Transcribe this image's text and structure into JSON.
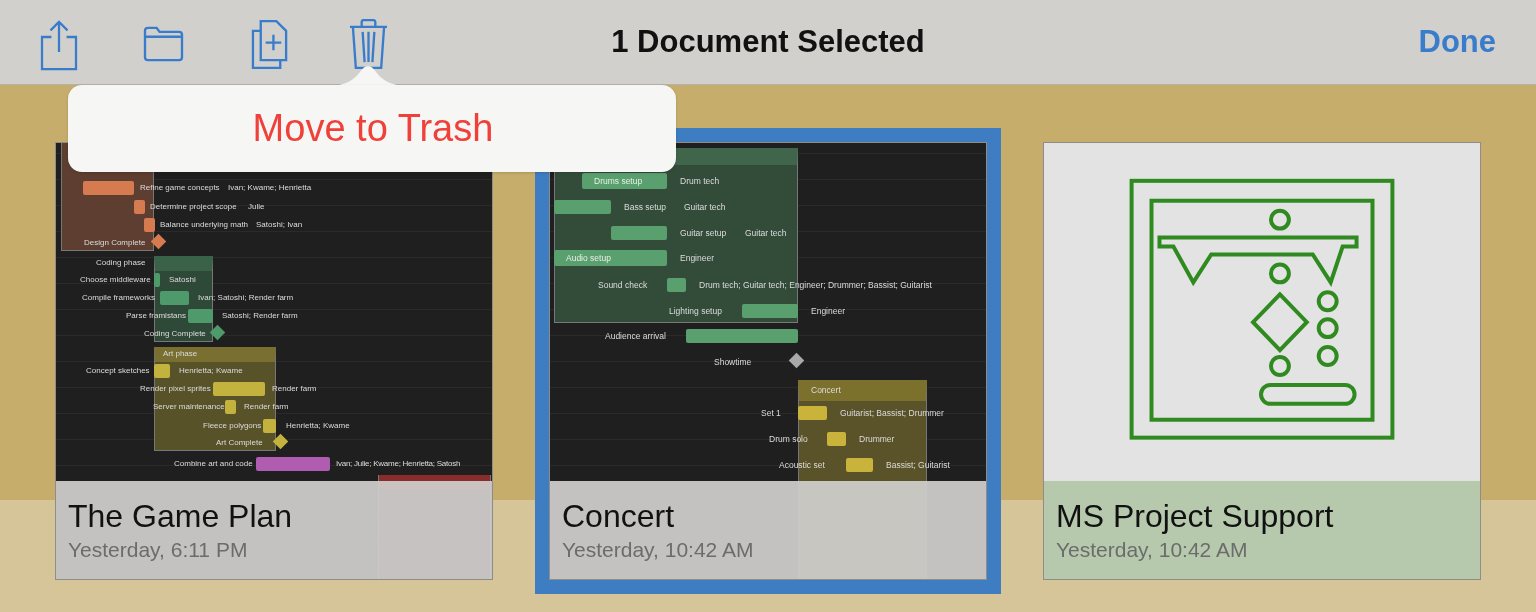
{
  "toolbar": {
    "title": "1 Document Selected",
    "done": "Done"
  },
  "popover": {
    "action": "Move to Trash"
  },
  "documents": [
    {
      "title": "The Game Plan",
      "date": "Yesterday, 6:11 PM",
      "selected": false,
      "thumbnail": {
        "kind": "gantt",
        "groups": [
          {
            "color": "#d67a50",
            "rows": [
              {
                "kind": "task",
                "name": "Refine game concepts",
                "resources": "Ivan; Kwame; Henrietta"
              },
              {
                "kind": "task",
                "name": "Determine project scope",
                "resources": "Julie"
              },
              {
                "kind": "task",
                "name": "Balance underlying math",
                "resources": "Satoshi; Ivan"
              },
              {
                "kind": "milestone",
                "name": "Design Complete"
              }
            ]
          },
          {
            "color": "#4f9a6a",
            "name": "Coding phase",
            "rows": [
              {
                "kind": "task",
                "name": "Choose middleware",
                "resources": "Satoshi"
              },
              {
                "kind": "task",
                "name": "Compile frameworks",
                "resources": "Ivan; Satoshi; Render farm"
              },
              {
                "kind": "task",
                "name": "Parse framistans",
                "resources": "Satoshi; Render farm"
              },
              {
                "kind": "milestone",
                "name": "Coding Complete"
              }
            ]
          },
          {
            "color": "#c4b23e",
            "name": "Art phase",
            "rows": [
              {
                "kind": "task",
                "name": "Concept sketches",
                "resources": "Henrietta; Kwame"
              },
              {
                "kind": "task",
                "name": "Render pixel sprites",
                "resources": "Render farm"
              },
              {
                "kind": "task",
                "name": "Server maintenance",
                "resources": "Render farm"
              },
              {
                "kind": "task",
                "name": "Fleece polygons",
                "resources": "Henrietta; Kwame"
              },
              {
                "kind": "milestone",
                "name": "Art Complete"
              }
            ]
          },
          {
            "color": "#b05cb0",
            "rows": [
              {
                "kind": "task",
                "name": "Combine art and code",
                "resources": "Ivan; Julie; Kwame; Henrietta; Satosh"
              }
            ]
          },
          {
            "color": "#8a2c2c"
          }
        ]
      }
    },
    {
      "title": "Concert",
      "date": "Yesterday, 10:42 AM",
      "selected": true,
      "thumbnail": {
        "kind": "gantt",
        "groups": [
          {
            "color": "#5aa06e",
            "rows": [
              {
                "kind": "task",
                "name": "Drums setup",
                "resources": "Drum tech"
              },
              {
                "kind": "task",
                "name": "Bass setup",
                "resources": "Guitar tech"
              },
              {
                "kind": "task",
                "name": "Guitar setup",
                "resources": "Guitar tech"
              },
              {
                "kind": "task",
                "name": "Audio setup",
                "resources": "Engineer"
              },
              {
                "kind": "task",
                "name": "Sound check",
                "resources": "Drum tech; Guitar tech; Engineer; Drummer; Bassist; Guitarist"
              },
              {
                "kind": "task",
                "name": "Lighting setup",
                "resources": "Engineer"
              }
            ]
          },
          {
            "color": "#5aa06e",
            "rows": [
              {
                "kind": "task",
                "name": "Audience arrival"
              }
            ]
          },
          {
            "color": "#a9a9a9",
            "rows": [
              {
                "kind": "milestone",
                "name": "Showtime"
              }
            ]
          },
          {
            "color": "#c9b33a",
            "name": "Concert",
            "rows": [
              {
                "kind": "task",
                "name": "Set 1",
                "resources": "Guitarist; Bassist; Drummer"
              },
              {
                "kind": "task",
                "name": "Drum solo",
                "resources": "Drummer"
              },
              {
                "kind": "task",
                "name": "Acoustic set",
                "resources": "Bassist; Guitarist"
              }
            ]
          }
        ]
      }
    },
    {
      "title": "MS Project Support",
      "date": "Yesterday, 10:42 AM",
      "selected": false,
      "thumbnail": {
        "kind": "flowchart"
      }
    }
  ]
}
